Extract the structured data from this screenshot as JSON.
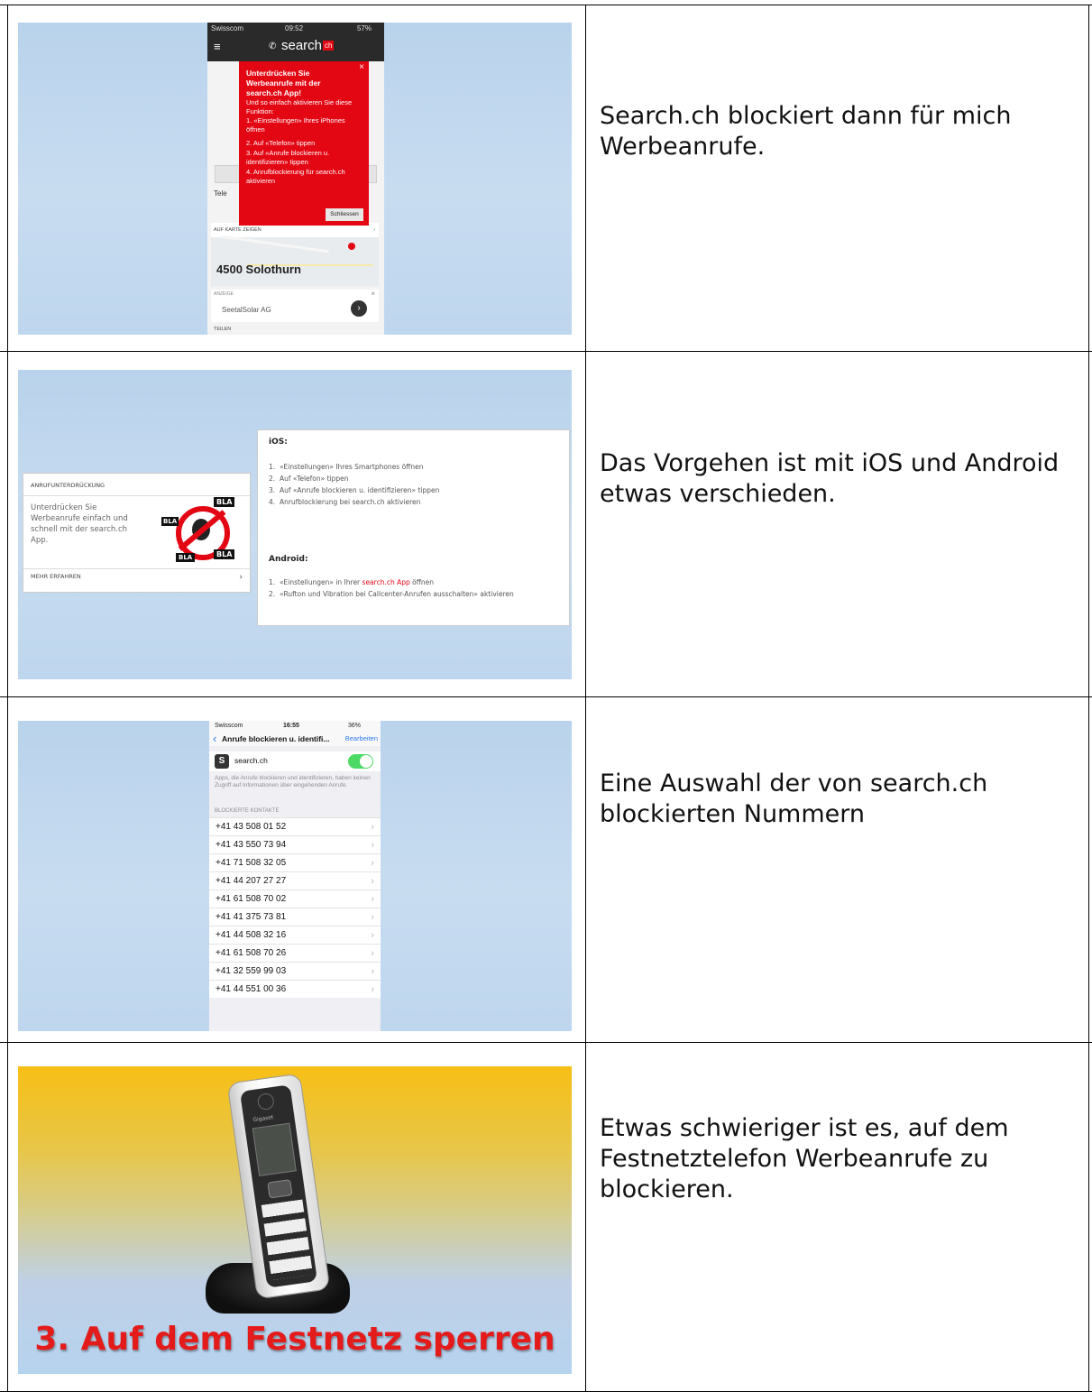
{
  "rows": [
    {
      "caption": "Search.ch blockiert dann für mich Werbeanrufe.",
      "phone": {
        "carrier": "Swisscom",
        "time": "09:52",
        "battery": "57%",
        "brand": "search",
        "brand_tld": "ch",
        "popup": {
          "title": "Unterdrücken Sie Werbeanrufe mit der search.ch App!",
          "intro": "Und so einfach aktivieren Sie diese Funktion:",
          "steps": [
            "1. «Einstellungen» Ihres iPhones öffnen",
            "2. Auf «Telefon» tippen",
            "3. Auf «Anrufe blockieren u. identifizieren» tippen",
            "4. Anrufblockierung für search.ch aktivieren"
          ],
          "close_label": "Schliessen",
          "close_x": "×"
        },
        "partial_label_left": "Tele",
        "map_label": "AUF KARTE ZEIGEN",
        "location": "4500 Solothurn",
        "ad_label": "ANZEIGE",
        "ad_text": "SeetalSolar AG",
        "share_label": "TEILEN"
      }
    },
    {
      "caption": "Das Vorgehen ist mit iOS und Android etwas verschieden.",
      "card": {
        "header": "ANRUFUNTERDRÜCKUNG",
        "body": "Unterdrücken Sie Werbeanrufe einfach und schnell mit der search.ch App.",
        "badge": "BLA",
        "more": "MEHR ERFAHREN"
      },
      "instructions": {
        "ios_title": "iOS:",
        "ios_steps": [
          "«Einstellungen» Ihres Smartphones öffnen",
          "Auf «Telefon» tippen",
          "Auf «Anrufe blockieren u. identifizieren» tippen",
          "Anrufblockierung bei search.ch aktivieren"
        ],
        "android_title": "Android:",
        "android_step1_pre": "«Einstellungen» in Ihrer ",
        "android_step1_link": "search.ch App",
        "android_step1_post": " öffnen",
        "android_step2": "«Rufton und Vibration bei Callcenter-Anrufen ausschalten» aktivieren"
      }
    },
    {
      "caption": "Eine Auswahl der von search.ch blockierten Nummern",
      "settings": {
        "carrier": "Swisscom",
        "time": "16:55",
        "battery": "36%",
        "back_title": "Anrufe blockieren u. identifi...",
        "edit": "Bearbeiten",
        "app_name": "search.ch",
        "note": "Apps, die Anrufe blockieren und identifizieren, haben keinen Zugriff auf Informationen über eingehenden Anrufe.",
        "section": "BLOCKIERTE KONTAKTE",
        "numbers": [
          "+41 43 508 01 52",
          "+41 43 550 73 94",
          "+41 71 508 32 05",
          "+41 44 207 27 27",
          "+41 61 508 70 02",
          "+41 41 375 73 81",
          "+41 44 508 32 16",
          "+41 61 508 70 26",
          "+41 32 559 99 03",
          "+41 44 551 00 36"
        ]
      }
    },
    {
      "caption": "Etwas schwieriger ist es, auf dem Festnetztelefon Werbeanrufe zu blockieren.",
      "slide_title": "3. Auf dem Festnetz sperren",
      "phone_brand": "Gigaset"
    }
  ],
  "colors": {
    "search_red": "#e30613",
    "ios_green": "#4cd964",
    "ios_blue": "#2f7cf6",
    "title_red": "#e41b1b"
  }
}
